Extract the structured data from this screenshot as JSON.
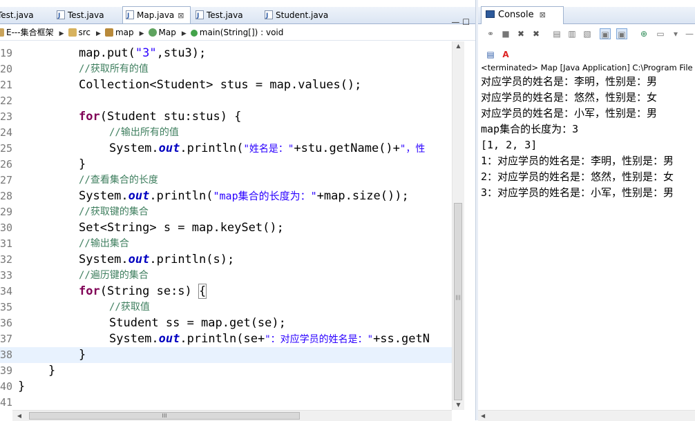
{
  "editor": {
    "tabs": [
      {
        "label": "Test.java",
        "active": false
      },
      {
        "label": "Test.java",
        "active": false
      },
      {
        "label": "Map.java",
        "active": true
      },
      {
        "label": "Test.java",
        "active": false
      },
      {
        "label": "Student.java",
        "active": false
      }
    ],
    "close_glyph": "⊠",
    "window_controls": "— ☐",
    "breadcrumb": [
      {
        "label": "E---集合框架",
        "icon": "project-icon"
      },
      {
        "label": "src",
        "icon": "source-folder-icon"
      },
      {
        "label": "map",
        "icon": "package-icon"
      },
      {
        "label": "Map",
        "icon": "class-icon"
      },
      {
        "label": "main(String[]) : void",
        "icon": "method-icon"
      }
    ],
    "line_numbers": [
      "19",
      "20",
      "21",
      "22",
      "23",
      "24",
      "25",
      "26",
      "27",
      "28",
      "29",
      "30",
      "31",
      "32",
      "33",
      "34",
      "35",
      "36",
      "37",
      "38",
      "39",
      "40",
      "41"
    ],
    "code": {
      "l19a": "map.put(",
      "l19b": "\"3\"",
      "l19c": ",stu3);",
      "l20": "//获取所有的值",
      "l21": "Collection<Student> stus = map.values();",
      "l23a": "for",
      "l23b": "(Student stu:stus) {",
      "l24": "//输出所有的值",
      "l25a": "System.",
      "l25b": "out",
      "l25c": ".println(",
      "l25d": "\"姓名是：\"",
      "l25e": "+stu.getName()+",
      "l25f": "\"，性",
      "l26": "}",
      "l27": "//查看集合的长度",
      "l28a": "System.",
      "l28b": "out",
      "l28c": ".println(",
      "l28d": "\"map集合的长度为：\"",
      "l28e": "+map.size());",
      "l29": "//获取键的集合",
      "l30": "Set<String> s = map.keySet();",
      "l31": "//输出集合",
      "l32a": "System.",
      "l32b": "out",
      "l32c": ".println(s);",
      "l33": "//遍历键的集合",
      "l34a": "for",
      "l34b": "(String se:s) ",
      "l34c": "{",
      "l35": "//获取值",
      "l36": "Student ss = map.get(se);",
      "l37a": "System.",
      "l37b": "out",
      "l37c": ".println(se+",
      "l37d": "\"：对应学员的姓名是：\"",
      "l37e": "+ss.getN",
      "l38": "}",
      "l39": "}",
      "l40": "}"
    },
    "scroll_up": "▲",
    "scroll_down": "▼",
    "scroll_left": "◀",
    "scroll_right": "▶",
    "grip": "|||",
    "hgrip": "III"
  },
  "console": {
    "tab_label": "Console",
    "close_glyph": "⊠",
    "status": "<terminated> Map [Java Application] C:\\Program File",
    "output": [
      "对应学员的姓名是：李明，性别是：男",
      "对应学员的姓名是：悠然，性别是：女",
      "对应学员的姓名是：小军，性别是：男",
      "map集合的长度为：3",
      "[1, 2, 3]",
      "1：对应学员的姓名是：李明，性别是：男",
      "2：对应学员的姓名是：悠然，性别是：女",
      "3：对应学员的姓名是：小军，性别是：男"
    ],
    "toolbar_icons": [
      "link-icon",
      "stop-icon",
      "remove-launch-icon",
      "remove-all-icon",
      "clear-console-icon",
      "scroll-lock-icon",
      "word-wrap-icon",
      "show-on-stdout-icon",
      "show-on-stderr-icon",
      "pin-console-icon",
      "display-console-icon",
      "dropdown-icon",
      "minimize-icon"
    ],
    "toolbar_glyphs": [
      "⚭",
      "■",
      "✖",
      "✖",
      "▤",
      "▥",
      "▧",
      "▣",
      "▣",
      "⊕",
      "▭",
      "▾",
      "—"
    ]
  }
}
